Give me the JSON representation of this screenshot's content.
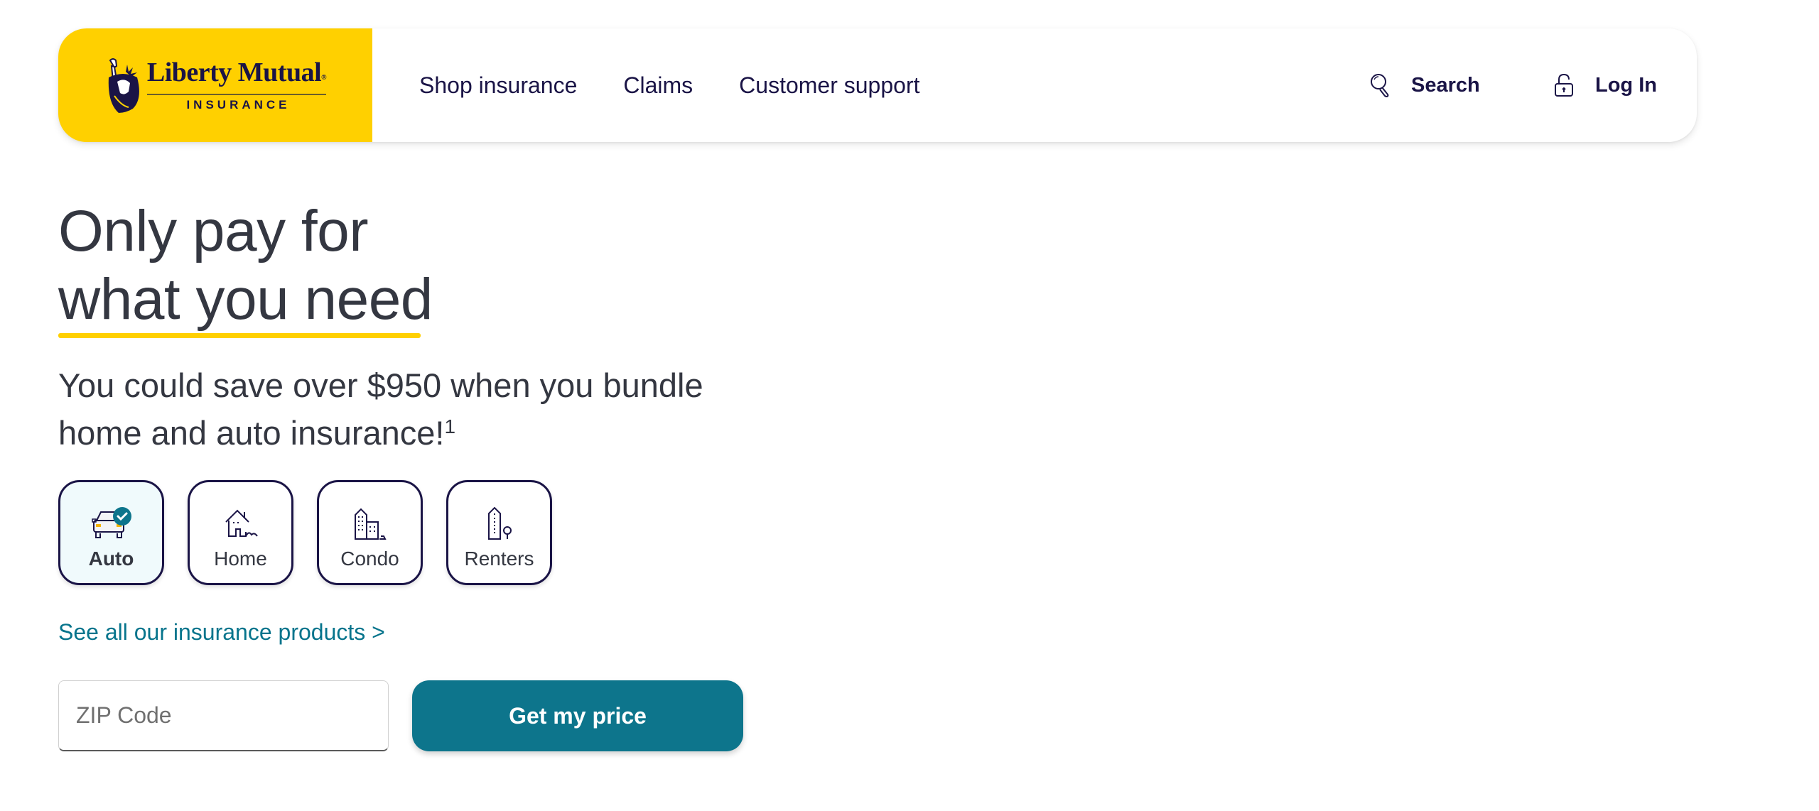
{
  "header": {
    "logo": {
      "name": "Liberty Mutual",
      "sub": "INSURANCE",
      "registered": "®",
      "brand_color": "#ffd000"
    },
    "nav": [
      {
        "label": "Shop insurance"
      },
      {
        "label": "Claims"
      },
      {
        "label": "Customer support"
      }
    ],
    "search": {
      "label": "Search",
      "icon": "search-icon"
    },
    "login": {
      "label": "Log In",
      "icon": "unlock-icon"
    }
  },
  "hero": {
    "headline_line1": "Only pay for",
    "headline_line2": "what you need",
    "subhead": "You could save over $950 when you bundle home and auto insurance!",
    "subhead_footnote": "1"
  },
  "products": {
    "items": [
      {
        "label": "Auto",
        "icon": "car-icon",
        "selected": true
      },
      {
        "label": "Home",
        "icon": "house-icon",
        "selected": false
      },
      {
        "label": "Condo",
        "icon": "condo-building-icon",
        "selected": false
      },
      {
        "label": "Renters",
        "icon": "apartment-tree-icon",
        "selected": false
      }
    ],
    "see_all_label": "See all our insurance products >"
  },
  "quote_form": {
    "zip_placeholder": "ZIP Code",
    "zip_value": "",
    "submit_label": "Get my price",
    "accent_color": "#0d758c"
  }
}
